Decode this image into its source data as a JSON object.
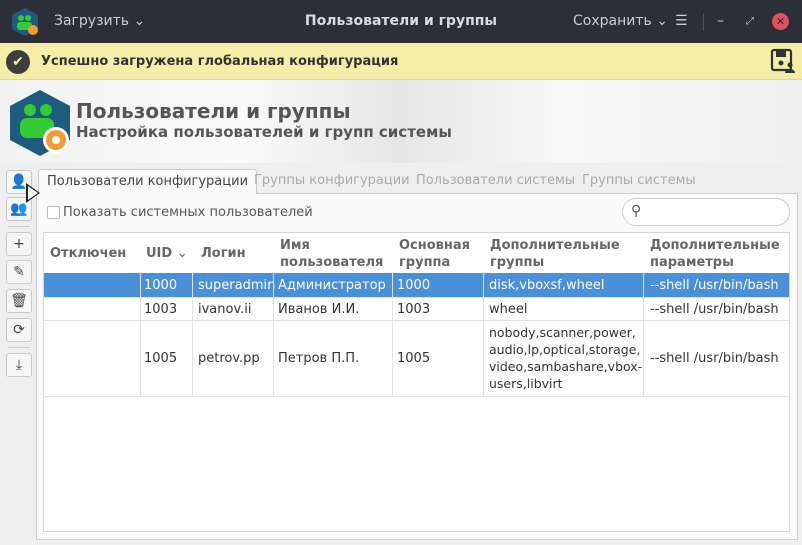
{
  "titlebar": {
    "load_label": "Загрузить",
    "title": "Пользователи и группы",
    "save_label": "Сохранить"
  },
  "banner": {
    "message": "Успешно загружена глобальная конфигурация"
  },
  "header": {
    "title": "Пользователи и группы",
    "subtitle": "Настройка пользователей и групп системы"
  },
  "tabs": [
    "Пользователи конфигурации",
    "Группы конфигурации",
    "Пользователи системы",
    "Группы системы"
  ],
  "show_system_users": {
    "label": "Показать системных пользователей",
    "checked": false
  },
  "search": {
    "placeholder": ""
  },
  "table": {
    "columns": [
      "Отключен",
      "UID",
      "Логин",
      "Имя пользователя",
      "Основная группа",
      "Дополнительные группы",
      "Дополнительные параметры"
    ],
    "rows": [
      {
        "disabled": "",
        "uid": "1000",
        "login": "superadmin",
        "name": "Администратор",
        "group": "1000",
        "extra_groups": "disk,vboxsf,wheel",
        "params": "--shell /usr/bin/bash",
        "selected": true
      },
      {
        "disabled": "",
        "uid": "1003",
        "login": "ivanov.ii",
        "name": "Иванов И.И.",
        "group": "1003",
        "extra_groups": "wheel",
        "params": "--shell /usr/bin/bash"
      },
      {
        "disabled": "",
        "uid": "1005",
        "login": "petrov.pp",
        "name": "Петров П.П.",
        "group": "1005",
        "extra_groups": "nobody,scanner,power, audio,lp,optical,storage, video,sambashare,vbox- users,libvirt",
        "params": "--shell /usr/bin/bash"
      }
    ]
  },
  "colors": {
    "titlebar": "#2c2f38",
    "banner": "#f5eea8",
    "selection": "#4a90d9",
    "close": "#e05260"
  }
}
